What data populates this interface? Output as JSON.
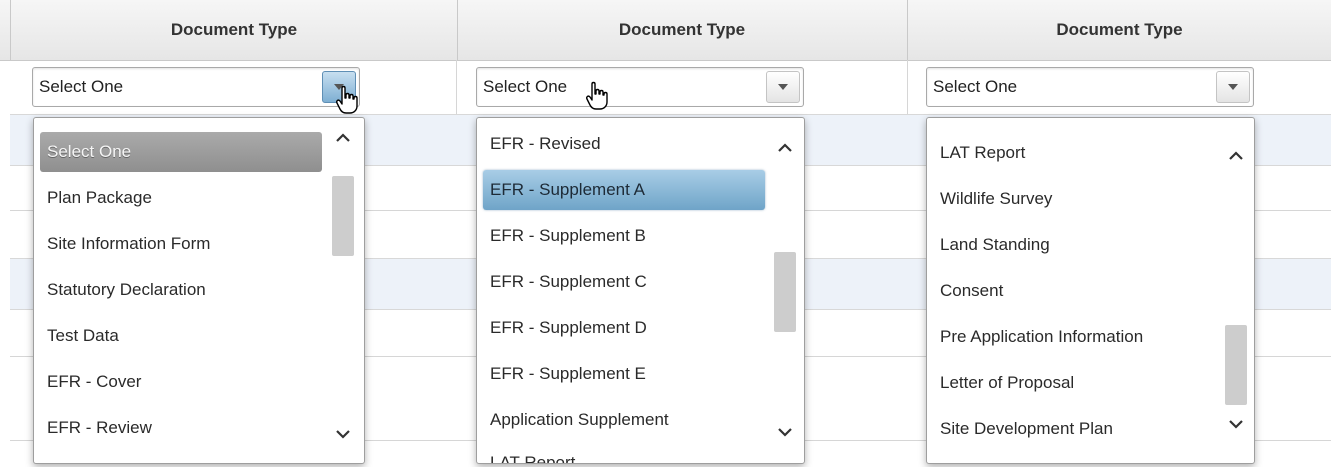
{
  "columns": [
    {
      "header": "Document Type",
      "selected_value": "Select One",
      "dropdown_options": [
        "Select One",
        "Plan Package",
        "Site Information Form",
        "Statutory Declaration",
        "Test Data",
        "EFR - Cover",
        "EFR - Review"
      ],
      "highlighted_option": "Select One"
    },
    {
      "header": "Document Type",
      "selected_value": "Select One",
      "dropdown_options": [
        "EFR - Revised",
        "EFR - Supplement A",
        "EFR - Supplement B",
        "EFR - Supplement C",
        "EFR - Supplement D",
        "EFR - Supplement E",
        "Application Supplement",
        "LAT Report"
      ],
      "highlighted_option": "EFR - Supplement A"
    },
    {
      "header": "Document Type",
      "selected_value": "Select One",
      "dropdown_options": [
        "LAT Report",
        "Wildlife Survey",
        "Land Standing",
        "Consent",
        "Pre Application Information",
        "Letter of Proposal",
        "Site Development Plan"
      ],
      "highlighted_option": ""
    }
  ],
  "icons": {
    "dropdown_arrow": "caret-down-icon",
    "scroll_up": "chevron-up-icon",
    "scroll_down": "chevron-down-icon",
    "cursor": "hand-pointer-icon"
  },
  "colors": {
    "highlight_grey": "#9d9d9d",
    "highlight_blue": "#8bbad9",
    "row_band": "#edf2f9"
  }
}
